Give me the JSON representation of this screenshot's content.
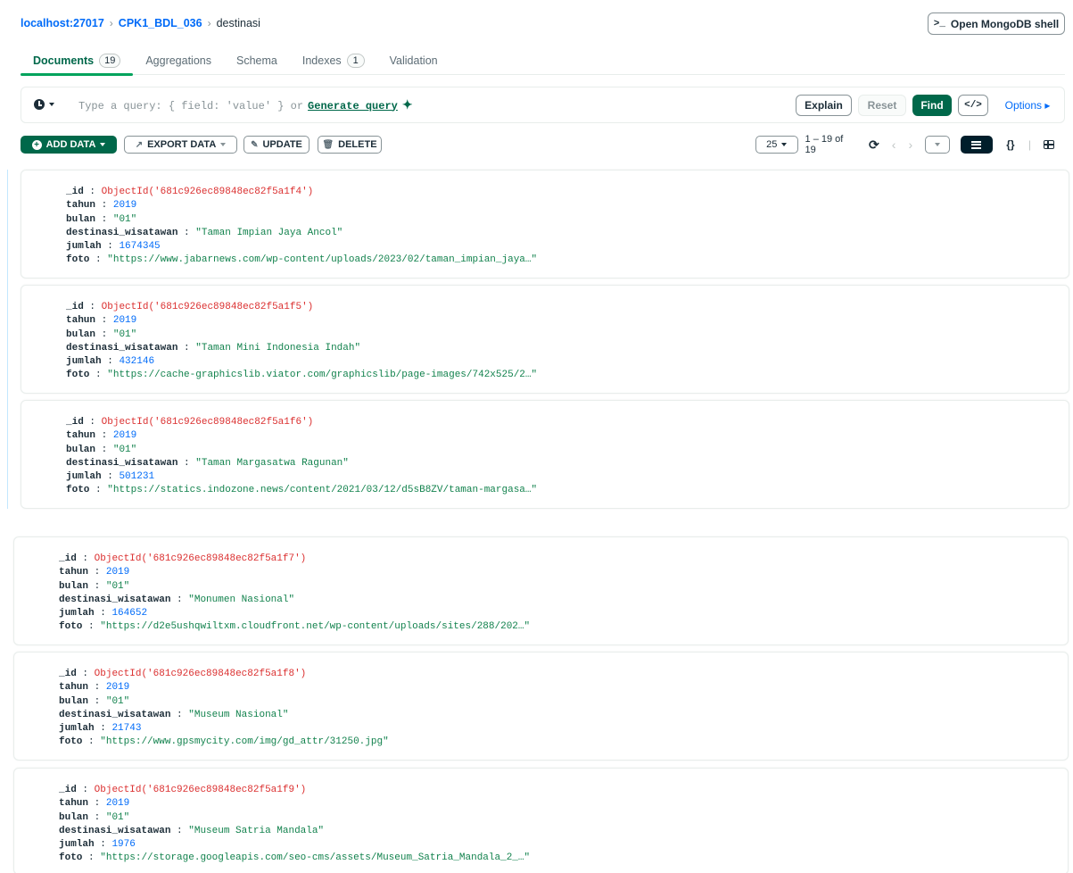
{
  "breadcrumb": {
    "host": "localhost:27017",
    "database": "CPK1_BDL_036",
    "collection": "destinasi",
    "separator": ">"
  },
  "shell_button": {
    "prompt": ">_",
    "label": "Open MongoDB shell"
  },
  "tabs": [
    {
      "label": "Documents",
      "count": "19",
      "active": true
    },
    {
      "label": "Aggregations",
      "count": null
    },
    {
      "label": "Schema",
      "count": null
    },
    {
      "label": "Indexes",
      "count": "1"
    },
    {
      "label": "Validation",
      "count": null
    }
  ],
  "query_bar": {
    "placeholder": "Type a query: { field: 'value' } or",
    "generate_label": "Generate query",
    "sparkle": "✦",
    "explain_label": "Explain",
    "reset_label": "Reset",
    "find_label": "Find",
    "code_label": "</>",
    "options_label": "Options ▸"
  },
  "toolbar": {
    "add_data_label": "ADD DATA",
    "export_data_label": "EXPORT DATA",
    "update_label": "UPDATE",
    "delete_label": "DELETE",
    "page_size": "25",
    "page_range": "1 – 19 of 19",
    "view_json_label": "{}"
  },
  "documents": [
    {
      "id": "ObjectId('681c926ec89848ec82f5a1f4')",
      "tahun": "2019",
      "bulan": "\"01\"",
      "destinasi_wisatawan": "\"Taman Impian Jaya Ancol\"",
      "jumlah": "1674345",
      "foto": "\"https://www.jabarnews.com/wp-content/uploads/2023/02/taman_impian_jaya…\""
    },
    {
      "id": "ObjectId('681c926ec89848ec82f5a1f5')",
      "tahun": "2019",
      "bulan": "\"01\"",
      "destinasi_wisatawan": "\"Taman Mini Indonesia Indah\"",
      "jumlah": "432146",
      "foto": "\"https://cache-graphicslib.viator.com/graphicslib/page-images/742x525/2…\""
    },
    {
      "id": "ObjectId('681c926ec89848ec82f5a1f6')",
      "tahun": "2019",
      "bulan": "\"01\"",
      "destinasi_wisatawan": "\"Taman Margasatwa Ragunan\"",
      "jumlah": "501231",
      "foto": "\"https://statics.indozone.news/content/2021/03/12/d5sB8ZV/taman-margasa…\""
    },
    {
      "id": "ObjectId('681c926ec89848ec82f5a1f7')",
      "tahun": "2019",
      "bulan": "\"01\"",
      "destinasi_wisatawan": "\"Monumen Nasional\"",
      "jumlah": "164652",
      "foto": "\"https://d2e5ushqwiltxm.cloudfront.net/wp-content/uploads/sites/288/202…\""
    },
    {
      "id": "ObjectId('681c926ec89848ec82f5a1f8')",
      "tahun": "2019",
      "bulan": "\"01\"",
      "destinasi_wisatawan": "\"Museum Nasional\"",
      "jumlah": "21743",
      "foto": "\"https://www.gpsmycity.com/img/gd_attr/31250.jpg\""
    },
    {
      "id": "ObjectId('681c926ec89848ec82f5a1f9')",
      "tahun": "2019",
      "bulan": "\"01\"",
      "destinasi_wisatawan": "\"Museum Satria Mandala\"",
      "jumlah": "1976",
      "foto": "\"https://storage.googleapis.com/seo-cms/assets/Museum_Satria_Mandala_2_…\""
    }
  ],
  "field_keys": {
    "id": "_id",
    "tahun": "tahun",
    "bulan": "bulan",
    "destinasi": "destinasi_wisatawan",
    "jumlah": "jumlah",
    "foto": "foto",
    "colon": ":"
  },
  "colors": {
    "accent": "#00684a",
    "link": "#016bf8",
    "objectid": "#db3030",
    "number": "#016bf8",
    "string": "#12824d"
  }
}
